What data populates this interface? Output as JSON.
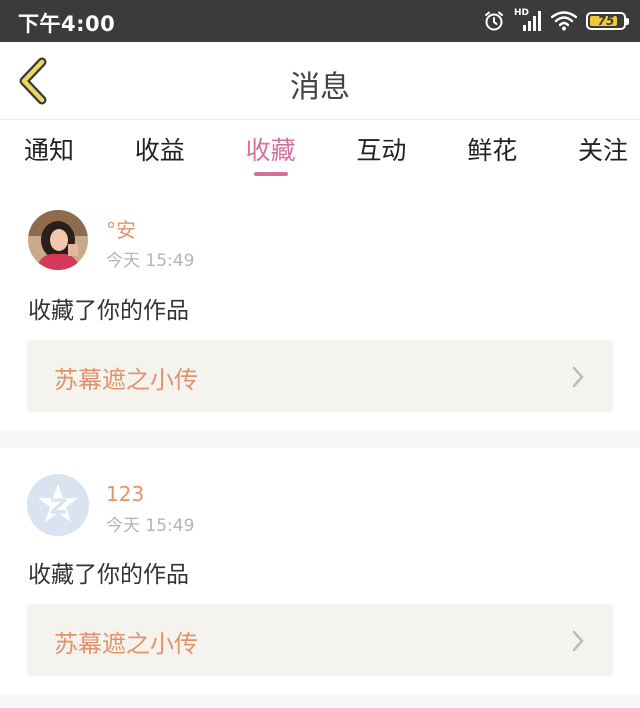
{
  "status_bar": {
    "time": "下午4:00",
    "network": "HD",
    "battery": "75"
  },
  "header": {
    "title": "消息"
  },
  "tabs": [
    {
      "label": "通知",
      "active": false
    },
    {
      "label": "收益",
      "active": false
    },
    {
      "label": "收藏",
      "active": true
    },
    {
      "label": "互动",
      "active": false
    },
    {
      "label": "鲜花",
      "active": false
    },
    {
      "label": "关注",
      "active": false
    }
  ],
  "messages": [
    {
      "user": "°安",
      "time": "今天 15:49",
      "text": "收藏了你的作品",
      "work_title": "苏幕遮之小传"
    },
    {
      "user": "123",
      "time": "今天 15:49",
      "text": "收藏了你的作品",
      "work_title": "苏幕遮之小传"
    }
  ],
  "colors": {
    "accent_pink": "#d7709c",
    "name_orange": "#e2936b",
    "status_bar_bg": "#3b3b3b",
    "battery_yellow": "#f3c93c"
  }
}
